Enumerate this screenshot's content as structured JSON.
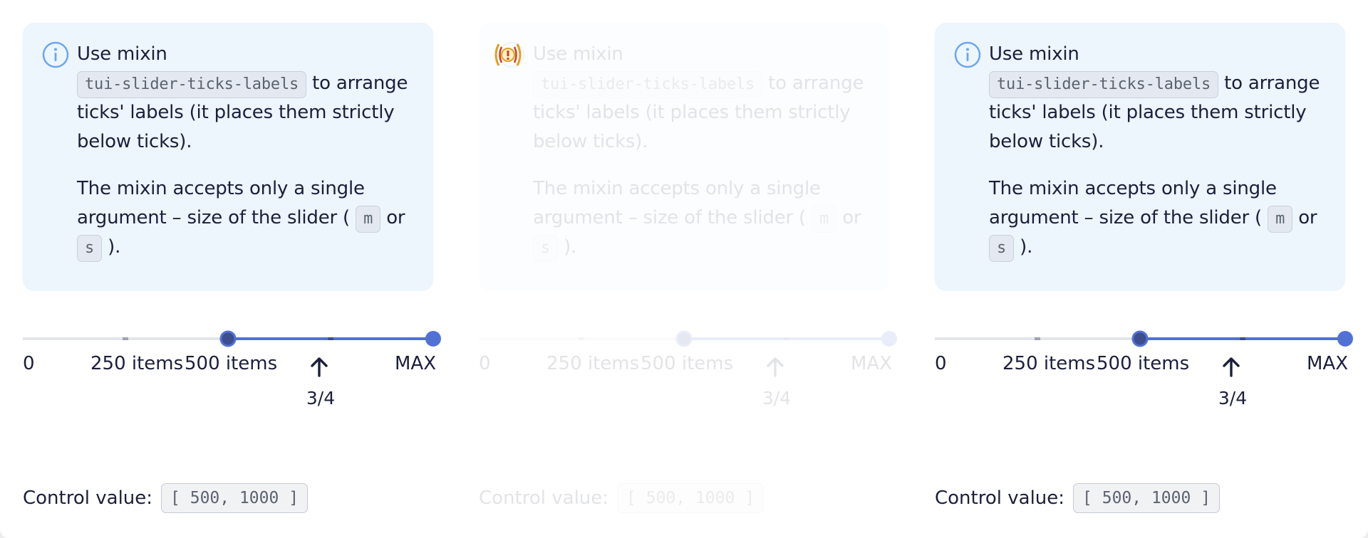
{
  "notice": {
    "line1_prefix": "Use mixin",
    "mixin_name": "tui-slider-ticks-labels",
    "line1_suffix": "to arrange ticks' labels (it places them strictly below ticks).",
    "line2_prefix": "The mixin accepts only a single argument – size of the slider (",
    "size_m": "m",
    "size_or": "or",
    "size_s": "s",
    "line2_suffix": ")."
  },
  "slider": {
    "min": 0,
    "max": 1000,
    "value": [
      500,
      1000
    ],
    "ticks": [
      0,
      250,
      500,
      750,
      1000
    ],
    "tick_labels": [
      "0",
      "250 items",
      "500 items",
      "MAX"
    ],
    "fraction_label": "3/4",
    "accent_color": "#5271d6",
    "thumb_inner_color": "#3d4d8f",
    "track_color": "#e3e5e9"
  },
  "control": {
    "label": "Control value:",
    "value": "[ 500, 1000 ]"
  },
  "icons": {
    "info": "info-icon",
    "arrow": "arrow-up-icon",
    "error": "error-icon"
  }
}
